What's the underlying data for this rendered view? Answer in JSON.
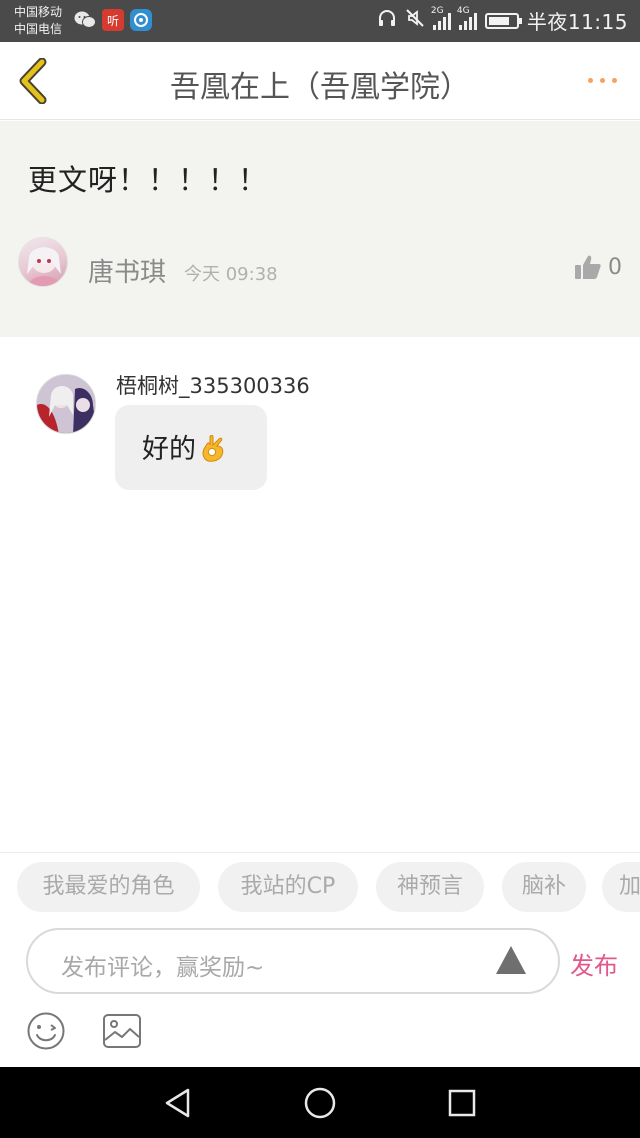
{
  "status_bar": {
    "carrier_1": "中国移动",
    "carrier_2": "中国电信",
    "ting_label": "听",
    "network_2g": "2G",
    "network_4g": "4G",
    "battery_level": 0.75,
    "time": "半夜11:15"
  },
  "nav": {
    "title": "吾凰在上（吾凰学院）"
  },
  "post": {
    "text": "更文呀！！！！！",
    "author": "唐书琪",
    "time": "今天 09:38",
    "likes": "0"
  },
  "comment": {
    "username": "梧桐树_335300336",
    "text": "好的"
  },
  "tags": [
    {
      "label": "我最爱的角色"
    },
    {
      "label": "我站的CP"
    },
    {
      "label": "神预言"
    },
    {
      "label": "脑补"
    },
    {
      "label": "加"
    }
  ],
  "input": {
    "placeholder": "发布评论，赢奖励~",
    "publish_label": "发布"
  },
  "colors": {
    "accent_orange": "#f5a25e",
    "back_yellow": "#d9b600",
    "publish_pink": "#e2578c",
    "post_bg": "#f3f3ef"
  },
  "icons": {
    "back": "chevron-left-icon",
    "more": "more-dots-icon",
    "like": "thumbs-up-icon",
    "send": "send-triangle-icon",
    "emoji": "smiley-icon",
    "image": "image-icon",
    "sys_back": "triangle-back-icon",
    "sys_home": "circle-home-icon",
    "sys_recent": "square-recent-icon"
  }
}
